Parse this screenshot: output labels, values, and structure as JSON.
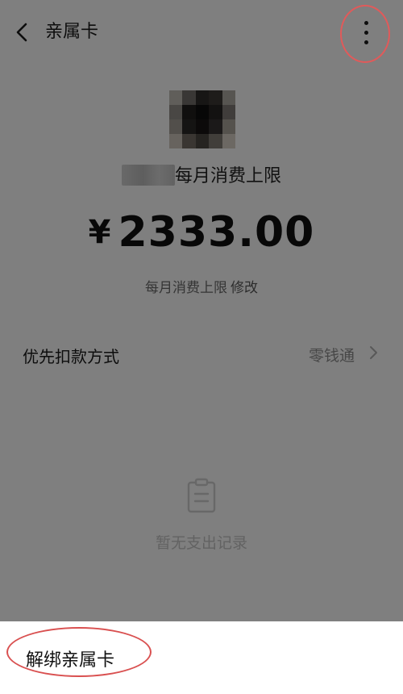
{
  "header": {
    "title": "亲属卡",
    "back_icon": "chevron-left-icon",
    "more_icon": "more-vertical-icon"
  },
  "card": {
    "limit_caption": "每月消费上限",
    "currency": "¥",
    "amount": "2333.00",
    "limit_line_label": "每月消费上限",
    "edit_label": "修改"
  },
  "payment": {
    "label": "优先扣款方式",
    "value": "零钱通",
    "chevron_icon": "chevron-right-icon"
  },
  "empty_state": {
    "icon": "clipboard-icon",
    "text": "暂无支出记录"
  },
  "sheet": {
    "item_label": "解绑亲属卡"
  },
  "colors": {
    "annotation_red": "#e15a5a",
    "overlay": "rgba(0,0,0,0.48)"
  }
}
